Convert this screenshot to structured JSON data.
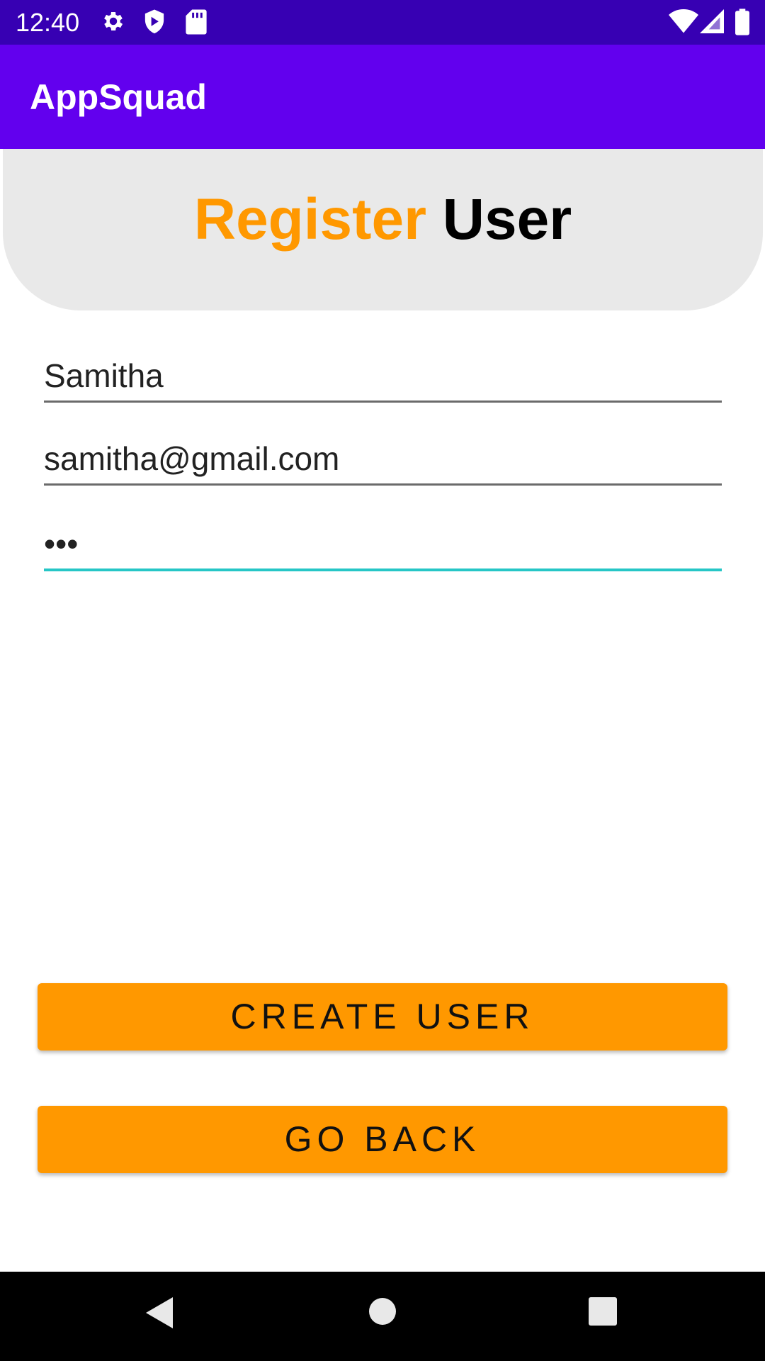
{
  "status_bar": {
    "time": "12:40",
    "icons": [
      "gear-icon",
      "shield-icon",
      "sd-card-icon",
      "wifi-icon",
      "signal-icon",
      "battery-icon"
    ]
  },
  "app_bar": {
    "title": "AppSquad"
  },
  "header": {
    "title_accent": "Register",
    "title_rest": "User",
    "accent_color": "#ff9800"
  },
  "form": {
    "name_value": "Samitha",
    "email_value": "samitha@gmail.com",
    "password_mask": "•••"
  },
  "buttons": {
    "create_label": "CREATE USER",
    "back_label": "GO BACK"
  },
  "colors": {
    "status_bar": "#3700b3",
    "app_bar": "#6200ee",
    "button": "#ff9800",
    "active_underline": "#26c6c6"
  },
  "nav_bar": {
    "icons": [
      "back-icon",
      "home-icon",
      "recents-icon"
    ]
  }
}
